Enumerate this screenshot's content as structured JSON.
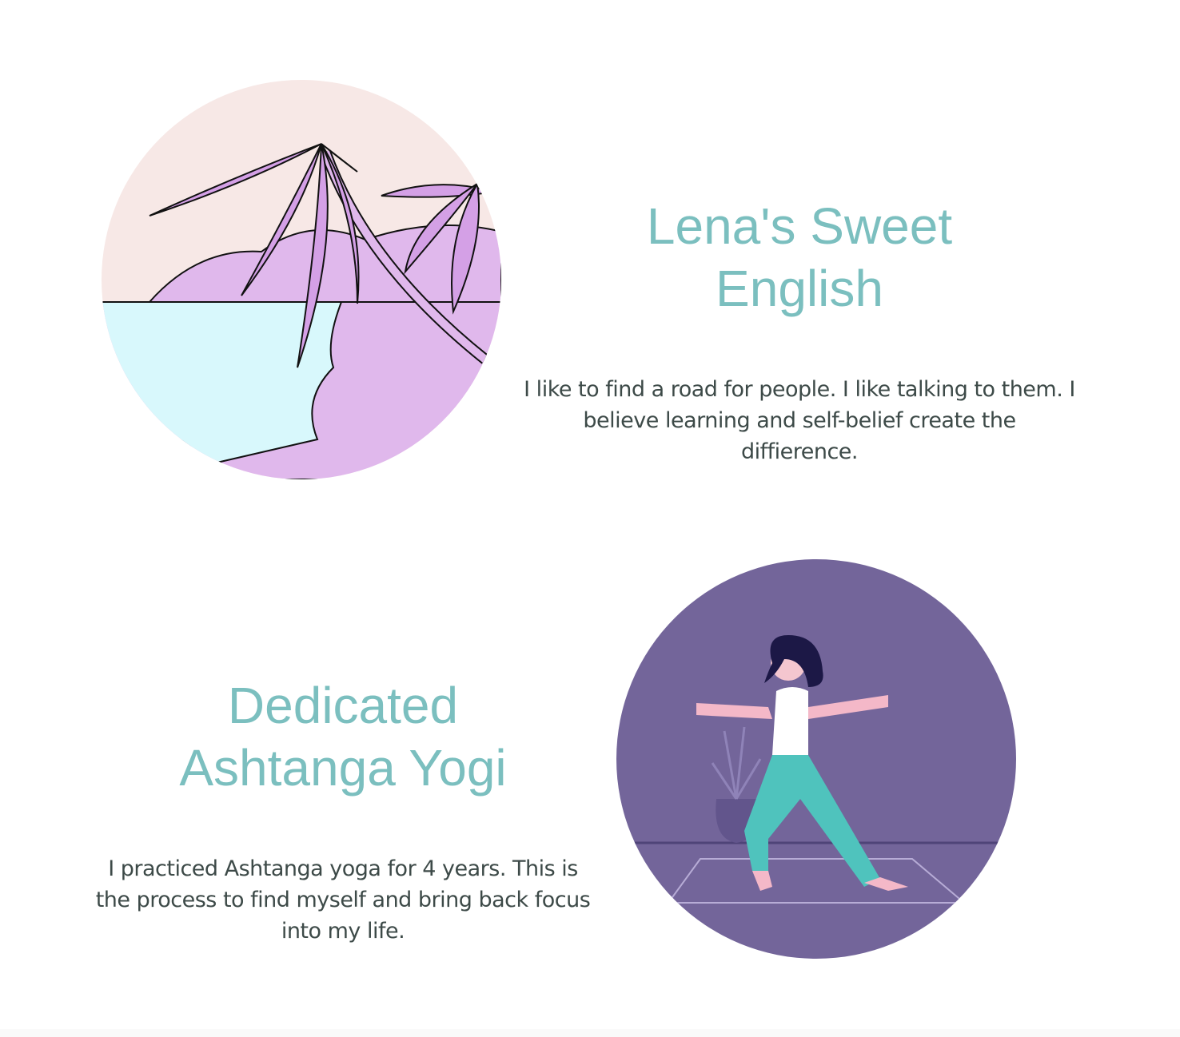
{
  "sections": [
    {
      "title_line1": "Lena's Sweet",
      "title_line2": "English",
      "description": "I like to find a road for people. I like talking to them. I believe learning and self-belief create the diffierence.",
      "illustration": "palm-beach-illustration"
    },
    {
      "title_line1": "Dedicated",
      "title_line2": "Ashtanga Yogi",
      "description": "I practiced Ashtanga yoga for 4 years. This is the process to find myself and bring back focus into my life.",
      "illustration": "yoga-warrior-illustration"
    }
  ],
  "colors": {
    "title": "#7bbfbf",
    "text": "#3d4a48",
    "beach_sky": "#f7e8e6",
    "beach_sand": "#e0b8ec",
    "beach_water": "#d8f8fc",
    "yoga_bg": "#73659a",
    "yoga_pants": "#4fc3bd"
  }
}
